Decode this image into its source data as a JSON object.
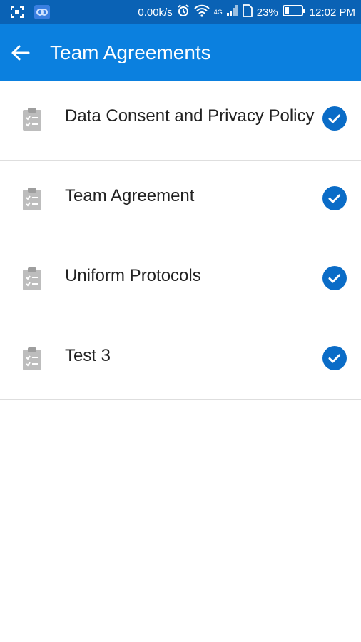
{
  "status_bar": {
    "network_speed": "0.00k/s",
    "network_type": "4G",
    "battery": "23%",
    "time": "12:02 PM",
    "icons": [
      "screenshot-icon",
      "app-notification-icon",
      "alarm-icon",
      "wifi-icon",
      "signal-icon",
      "sim-icon",
      "battery-icon"
    ]
  },
  "app_bar": {
    "title": "Team Agreements",
    "back_icon": "arrow-left-icon",
    "color": "#0b80df"
  },
  "agreements": [
    {
      "label": "Data Consent and Privacy Policy",
      "status": "accepted"
    },
    {
      "label": "Team Agreement",
      "status": "accepted"
    },
    {
      "label": "Uniform Protocols",
      "status": "accepted"
    },
    {
      "label": "Test 3",
      "status": "accepted"
    }
  ],
  "colors": {
    "status_bar": "#0a62b5",
    "accent": "#0b80df",
    "check": "#0a6cc7",
    "icon_gray": "#b8b8b8"
  }
}
